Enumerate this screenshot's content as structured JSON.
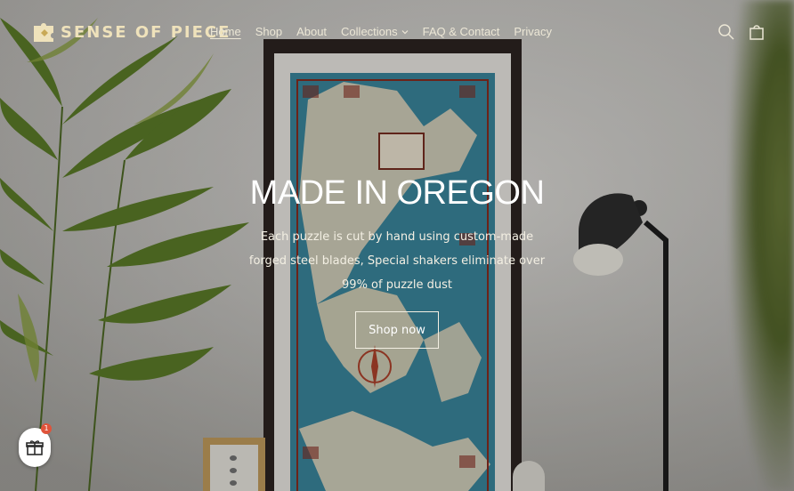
{
  "brand": {
    "name": "SENSE OF PIECE"
  },
  "nav": {
    "items": [
      {
        "label": "Home",
        "active": true
      },
      {
        "label": "Shop"
      },
      {
        "label": "About"
      },
      {
        "label": "Collections",
        "has_dropdown": true
      },
      {
        "label": "FAQ & Contact"
      },
      {
        "label": "Privacy"
      }
    ]
  },
  "header_icons": [
    "search-icon",
    "cart-icon"
  ],
  "hero": {
    "title": "MADE IN OREGON",
    "subtitle": "Each puzzle is cut by hand using custom-made forged steel blades, Special shakers eliminate over 99% of puzzle dust",
    "button_label": "Shop now"
  },
  "gift_widget": {
    "icon": "gift-icon",
    "badge_count": "1"
  },
  "colors": {
    "brand_gold": "#efe2bb",
    "badge_red": "#e0533a",
    "map_blue": "#3f8aa0"
  }
}
